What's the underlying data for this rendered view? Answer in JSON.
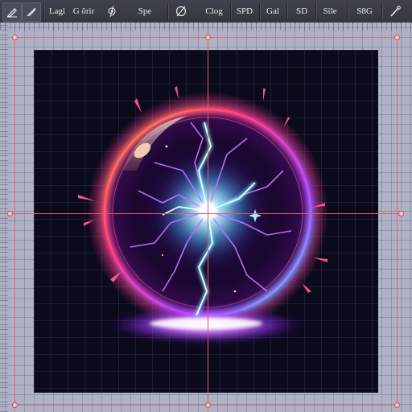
{
  "toolbar": {
    "items": [
      {
        "label": "Lagi"
      },
      {
        "label": "G ôrir"
      },
      {
        "label": "Spe"
      },
      {
        "label": "Clog"
      },
      {
        "label": "SPD"
      },
      {
        "label": "Gal"
      },
      {
        "label": "SD"
      },
      {
        "label": "Sile"
      },
      {
        "label": "S8G"
      }
    ]
  },
  "icons": {
    "toolbar_left_1": "brush-box-icon",
    "toolbar_left_2": "pen-slash-icon",
    "toolbar_3": "spiral-icon",
    "toolbar_4": "circle-slash-icon",
    "toolbar_right": "pen-tool-icon"
  },
  "colors": {
    "toolbar_bg": "#383a45",
    "workspace_bg": "#aeb2c4",
    "canvas_bg": "#0b0a1a",
    "guide": "#e05a6a",
    "orb_pink": "#ff4fa3",
    "orb_orange": "#ff7a3a",
    "lightning_cyan": "#6ff0ff",
    "lightning_purple": "#c070ff"
  }
}
